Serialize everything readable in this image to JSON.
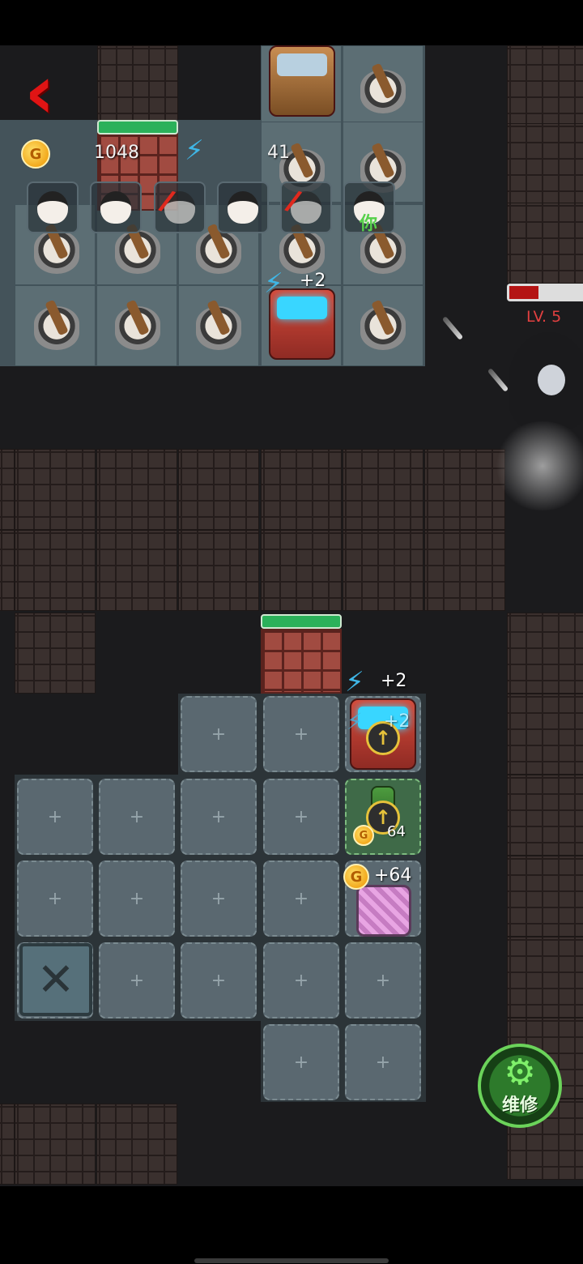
{
  "hud": {
    "gold_amount": "1048",
    "energy_amount": "41",
    "coin_letter": "G"
  },
  "party": {
    "you_label": "你"
  },
  "enemy": {
    "level_label": "LV. 5",
    "hp_fraction": 0.38
  },
  "gains": {
    "top_arcade": "+2",
    "lower_arcade": "+2",
    "lower_arcade_shadow": "+2",
    "bed_gold": "+64",
    "bottle_gold": "64"
  },
  "actions": {
    "repair_label": "维修"
  },
  "colors": {
    "back_arrow": "#e01414",
    "energy_bolt": "#3fb6e6",
    "door_hp": "#2bb15a",
    "enemy_hp": "#b41414",
    "repair_button": "#2d7a2b"
  },
  "icons": {
    "back": "back-arrow-icon",
    "gold": "gold-coin-icon",
    "energy": "lightning-bolt-icon",
    "repair": "gear-wrench-icon",
    "upgrade": "up-arrow-icon"
  }
}
